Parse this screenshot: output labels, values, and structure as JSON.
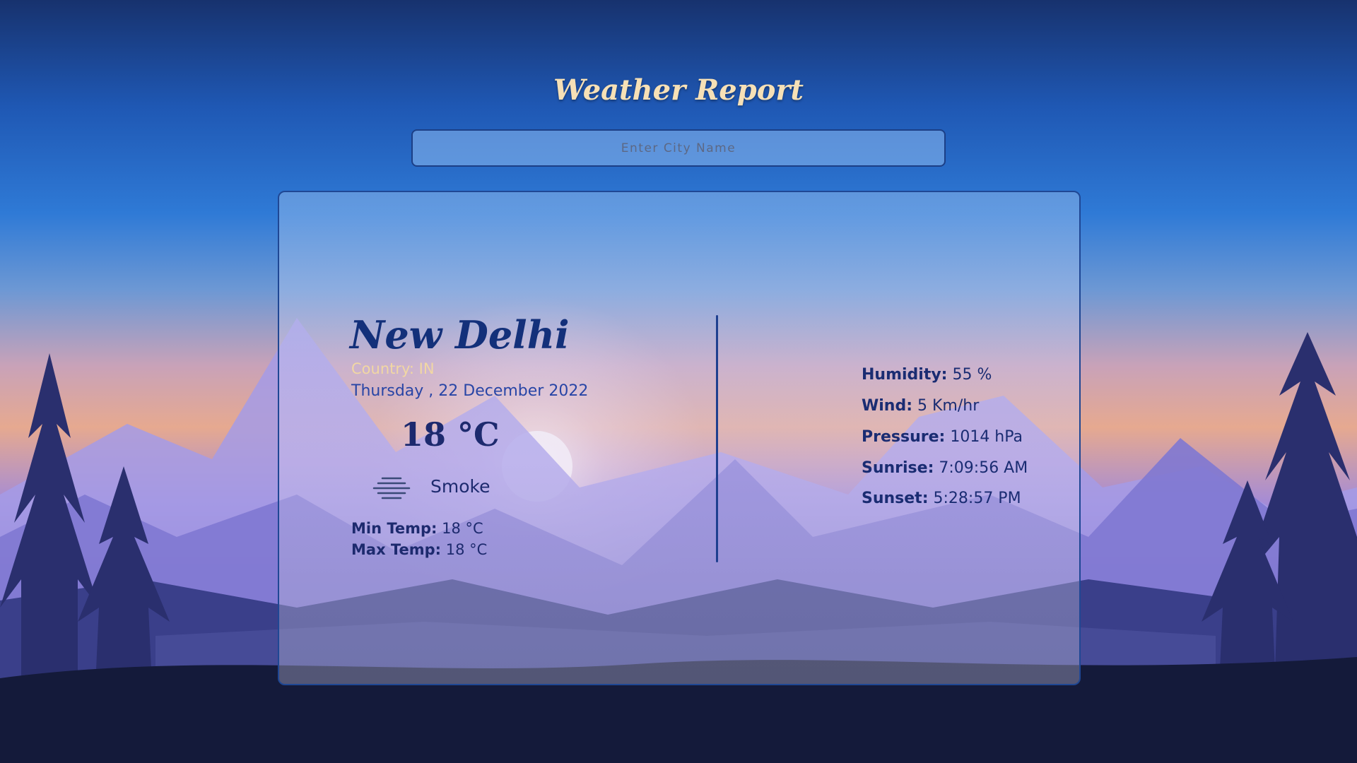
{
  "app": {
    "title": "Weather Report"
  },
  "search": {
    "placeholder": "Enter City Name"
  },
  "weather": {
    "city": "New Delhi",
    "country_label": "Country:",
    "country_value": "IN",
    "date": "Thursday , 22 December 2022",
    "temperature": "18 °C",
    "condition": "Smoke",
    "condition_icon": "smoke-haze-icon",
    "min_temp_label": "Min Temp:",
    "min_temp_value": "18 °C",
    "max_temp_label": "Max Temp:",
    "max_temp_value": "18 °C"
  },
  "details": [
    {
      "label": "Humidity:",
      "value": "55 %"
    },
    {
      "label": "Wind:",
      "value": "5 Km/hr"
    },
    {
      "label": "Pressure:",
      "value": "1014 hPa"
    },
    {
      "label": "Sunrise:",
      "value": "7:09:56 AM"
    },
    {
      "label": "Sunset:",
      "value": "5:28:57 PM"
    }
  ],
  "colors": {
    "title": "#f6e0b6",
    "city": "#13307a",
    "country": "#f1d7a3",
    "date": "#2845a6",
    "text": "#1d2a6e",
    "card_border": "#1f4794"
  }
}
